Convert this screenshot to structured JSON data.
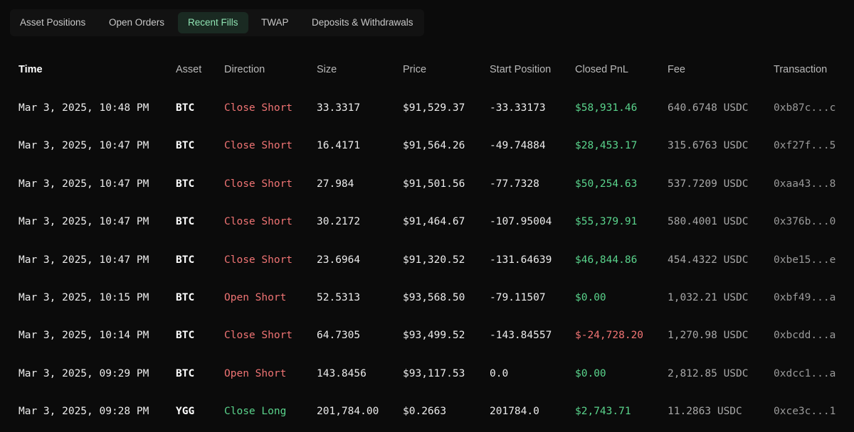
{
  "tabs": [
    {
      "label": "Asset Positions"
    },
    {
      "label": "Open Orders"
    },
    {
      "label": "Recent Fills"
    },
    {
      "label": "TWAP"
    },
    {
      "label": "Deposits & Withdrawals"
    }
  ],
  "active_tab": "Recent Fills",
  "columns": {
    "time": "Time",
    "asset": "Asset",
    "direction": "Direction",
    "size": "Size",
    "price": "Price",
    "start_position": "Start Position",
    "closed_pnl": "Closed PnL",
    "fee": "Fee",
    "transaction": "Transaction"
  },
  "colors": {
    "short": "#f07474",
    "long": "#5ad48c",
    "positive_pnl": "#5ad48c",
    "negative_pnl": "#f07474",
    "active_tab_text": "#8fe3b3"
  },
  "rows": [
    {
      "time": "Mar 3, 2025, 10:48 PM",
      "asset": "BTC",
      "direction": "Close Short",
      "size": "33.3317",
      "price": "$91,529.37",
      "start_position": "-33.33173",
      "closed_pnl": "$58,931.46",
      "fee": "640.6748 USDC",
      "transaction": "0xb87c...c"
    },
    {
      "time": "Mar 3, 2025, 10:47 PM",
      "asset": "BTC",
      "direction": "Close Short",
      "size": "16.4171",
      "price": "$91,564.26",
      "start_position": "-49.74884",
      "closed_pnl": "$28,453.17",
      "fee": "315.6763 USDC",
      "transaction": "0xf27f...5"
    },
    {
      "time": "Mar 3, 2025, 10:47 PM",
      "asset": "BTC",
      "direction": "Close Short",
      "size": "27.984",
      "price": "$91,501.56",
      "start_position": "-77.7328",
      "closed_pnl": "$50,254.63",
      "fee": "537.7209 USDC",
      "transaction": "0xaa43...8"
    },
    {
      "time": "Mar 3, 2025, 10:47 PM",
      "asset": "BTC",
      "direction": "Close Short",
      "size": "30.2172",
      "price": "$91,464.67",
      "start_position": "-107.95004",
      "closed_pnl": "$55,379.91",
      "fee": "580.4001 USDC",
      "transaction": "0x376b...0"
    },
    {
      "time": "Mar 3, 2025, 10:47 PM",
      "asset": "BTC",
      "direction": "Close Short",
      "size": "23.6964",
      "price": "$91,320.52",
      "start_position": "-131.64639",
      "closed_pnl": "$46,844.86",
      "fee": "454.4322 USDC",
      "transaction": "0xbe15...e"
    },
    {
      "time": "Mar 3, 2025, 10:15 PM",
      "asset": "BTC",
      "direction": "Open Short",
      "size": "52.5313",
      "price": "$93,568.50",
      "start_position": "-79.11507",
      "closed_pnl": "$0.00",
      "fee": "1,032.21 USDC",
      "transaction": "0xbf49...a"
    },
    {
      "time": "Mar 3, 2025, 10:14 PM",
      "asset": "BTC",
      "direction": "Close Short",
      "size": "64.7305",
      "price": "$93,499.52",
      "start_position": "-143.84557",
      "closed_pnl": "$-24,728.20",
      "fee": "1,270.98 USDC",
      "transaction": "0xbcdd...a"
    },
    {
      "time": "Mar 3, 2025, 09:29 PM",
      "asset": "BTC",
      "direction": "Open Short",
      "size": "143.8456",
      "price": "$93,117.53",
      "start_position": "0.0",
      "closed_pnl": "$0.00",
      "fee": "2,812.85 USDC",
      "transaction": "0xdcc1...a"
    },
    {
      "time": "Mar 3, 2025, 09:28 PM",
      "asset": "YGG",
      "direction": "Close Long",
      "size": "201,784.00",
      "price": "$0.2663",
      "start_position": "201784.0",
      "closed_pnl": "$2,743.71",
      "fee": "11.2863 USDC",
      "transaction": "0xce3c...1"
    }
  ]
}
